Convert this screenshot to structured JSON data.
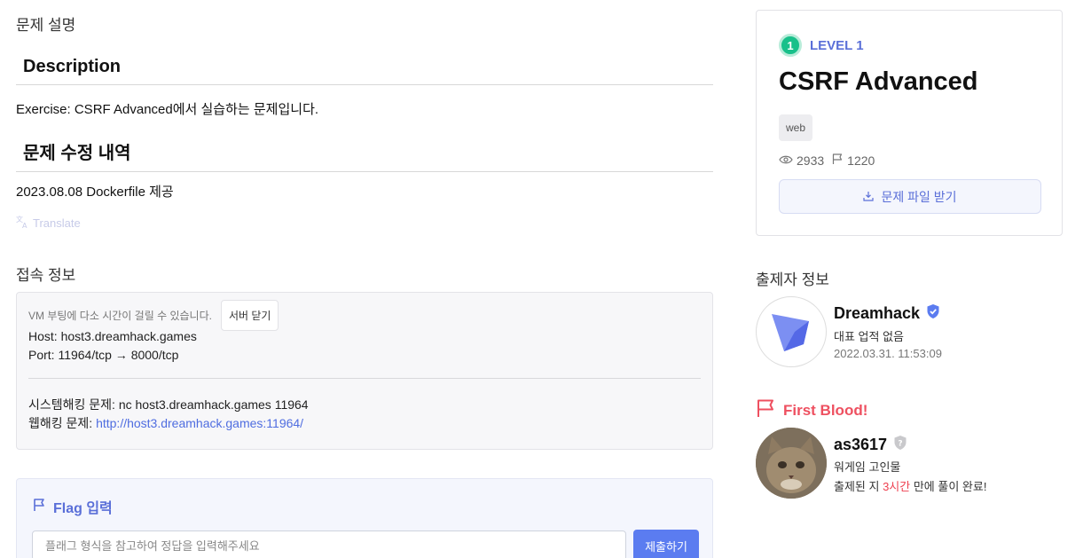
{
  "left": {
    "problem_section_title": "문제 설명",
    "description_heading": "Description",
    "description_text": "Exercise: CSRF Advanced에서 실습하는 문제입니다.",
    "changelog_heading": "문제 수정 내역",
    "changelog_text": "2023.08.08 Dockerfile 제공",
    "translate_label": "Translate",
    "access_section_title": "접속 정보",
    "access": {
      "vm_note": "VM 부팅에 다소 시간이 걸릴 수 있습니다.",
      "close_server_label": "서버 닫기",
      "host_line": "Host: host3.dreamhack.games",
      "port_line": "Port:  11964/tcp → 8000/tcp",
      "system_hacking_line": "시스템해킹 문제: nc host3.dreamhack.games 11964",
      "web_hacking_prefix": "웹해킹 문제: ",
      "web_hacking_url": "http://host3.dreamhack.games:11964/"
    },
    "flag": {
      "title": "Flag 입력",
      "placeholder": "플래그 형식을 참고하여 정답을 입력해주세요",
      "submit_label": "제출하기"
    }
  },
  "card": {
    "level_number": "1",
    "level_label": "LEVEL 1",
    "challenge_title": "CSRF Advanced",
    "tag": "web",
    "views": "2933",
    "solves": "1220",
    "download_label": "문제 파일 받기"
  },
  "author": {
    "section_title": "출제자 정보",
    "name": "Dreamhack",
    "subtitle": "대표 업적 없음",
    "date": "2022.03.31. 11:53:09"
  },
  "first_blood": {
    "title": "First Blood!",
    "name": "as3617",
    "subtitle": "워게임 고인물",
    "msg_prefix": "출제된 지 ",
    "msg_time": "3시간",
    "msg_suffix": " 만에 풀이 완료!"
  },
  "colors": {
    "accent": "#5a6fd8",
    "level_green": "#19c08a",
    "first_blood_red": "#ee5060",
    "submit_blue": "#5b7cf0"
  }
}
